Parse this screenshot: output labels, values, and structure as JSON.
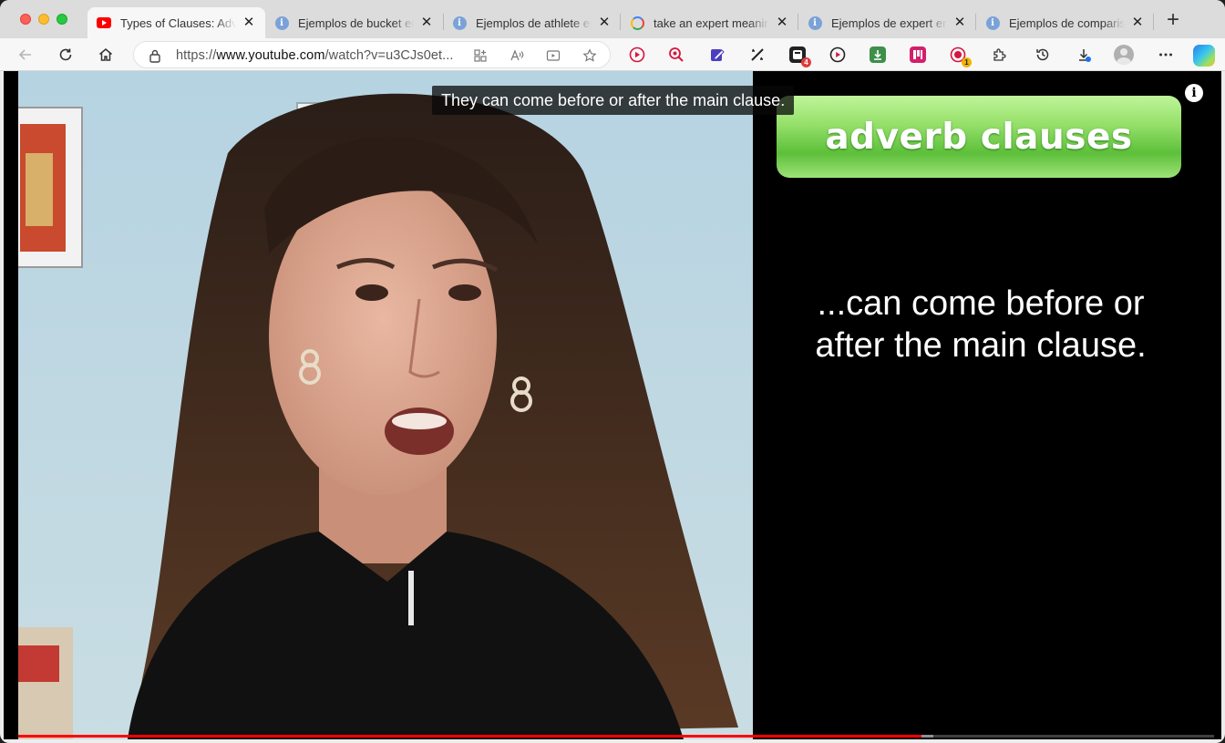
{
  "browser": {
    "tabs": [
      {
        "title": "Types of Clauses: Adverb Clauses",
        "favicon": "youtube-icon",
        "active": true
      },
      {
        "title": "Ejemplos de bucket en inglés",
        "favicon": "info-icon",
        "active": false
      },
      {
        "title": "Ejemplos de athlete en inglés",
        "favicon": "info-icon",
        "active": false
      },
      {
        "title": "take an expert meaning",
        "favicon": "google-icon",
        "active": false
      },
      {
        "title": "Ejemplos de expert en inglés",
        "favicon": "info-icon",
        "active": false
      },
      {
        "title": "Ejemplos de comparison en inglés",
        "favicon": "info-icon",
        "active": false
      }
    ],
    "new_tab_label": "+",
    "url_prefix": "https://",
    "url_host": "www.youtube.com",
    "url_path": "/watch?v=u3CJs0et...",
    "extension_badges": {
      "ext5": "4",
      "ext9": "1"
    }
  },
  "video": {
    "caption": "They can come before or after the main clause.",
    "slide_title": "adverb clauses",
    "slide_line1": "...can come before or",
    "slide_line2": "after the main clause.",
    "info_label": "i",
    "progress_played": 0.755,
    "progress_buffered": 0.765
  },
  "colors": {
    "accent": "#ff0000",
    "slide_green": "#7ad24f",
    "toolbar_bg": "#f7f7f7"
  }
}
